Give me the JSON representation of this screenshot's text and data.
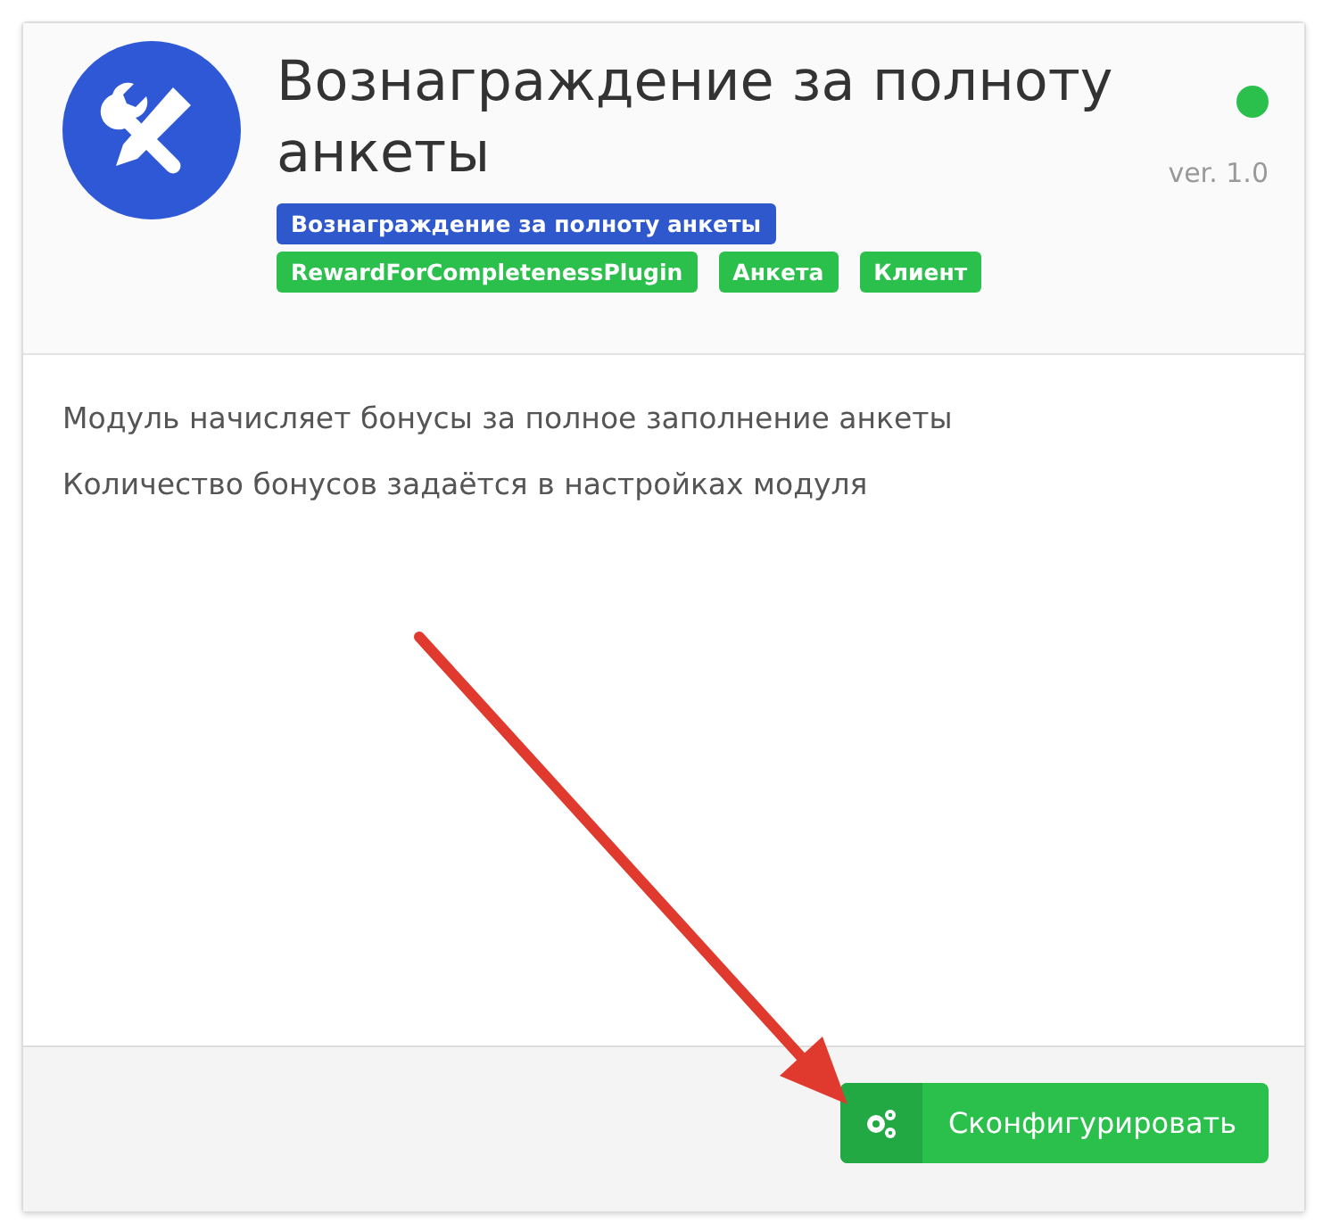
{
  "module": {
    "title": "Вознаграждение за полноту анкеты",
    "active": true,
    "version": "ver. 1.0",
    "tags": [
      {
        "label": "Вознаграждение за полноту анкеты",
        "color": "#2f58cd"
      },
      {
        "label": "RewardForCompletenessPlugin",
        "color": "#2bbf4c"
      },
      {
        "label": "Анкета",
        "color": "#2bbf4c"
      },
      {
        "label": "Клиент",
        "color": "#2bbf4c"
      }
    ],
    "description": [
      "Модуль начисляет бонусы за полное заполнение анкеты",
      "Количество бонусов задаётся в настройках модуля"
    ],
    "button": "Сконфигурировать"
  }
}
